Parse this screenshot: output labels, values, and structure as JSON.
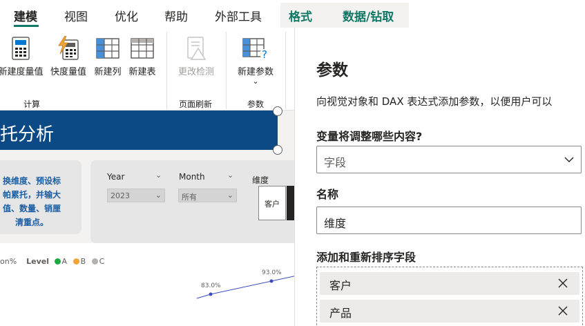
{
  "tabs": [
    {
      "label": "建模",
      "active": true
    },
    {
      "label": "视图"
    },
    {
      "label": "优化"
    },
    {
      "label": "帮助"
    },
    {
      "label": "外部工具"
    },
    {
      "label": "格式",
      "contextual": true
    },
    {
      "label": "数据/钻取",
      "contextual": true
    }
  ],
  "ribbon": {
    "buttons": {
      "new_measure": "新建度量值",
      "quick_measure": "快度量值",
      "new_column": "新建列",
      "new_table": "新建表",
      "change_detection": "更改检测",
      "new_parameter": "新建参数"
    },
    "groups": {
      "calc": "计算",
      "page_refresh": "页面刷新",
      "params": "参数"
    }
  },
  "report": {
    "title": "托分析",
    "description": "换维度、预设标帕累托，并输大值、数量、销厘清重点。",
    "filters": {
      "year_label": "Year",
      "year_value": "2023",
      "month_label": "Month",
      "month_value": "所有",
      "dimension_label": "维度",
      "dimension_button": "客户"
    },
    "legend": {
      "prefix": "on%",
      "level_label": "Level",
      "items": [
        {
          "label": "A",
          "color": "#1aab40"
        },
        {
          "label": "B",
          "color": "#f2a33a"
        },
        {
          "label": "C",
          "color": "#b3b0ad"
        }
      ]
    }
  },
  "chart_data": {
    "type": "line",
    "series": [
      {
        "values": [
          83.0,
          93.0
        ]
      }
    ],
    "data_labels": [
      "83.0%",
      "93.0%"
    ],
    "color": "#3a4bc0"
  },
  "pane": {
    "title": "参数",
    "description": "向视觉对象和 DAX 表达式添加参数，以便用户可以",
    "variable_label": "变量将调整哪些内容?",
    "variable_value": "字段",
    "name_label": "名称",
    "name_value": "维度",
    "fields_label": "添加和重新排序字段",
    "fields": [
      {
        "name": "客户"
      },
      {
        "name": "产品"
      }
    ]
  },
  "colors": {
    "accent": "#117865",
    "banner": "#0c4a86",
    "desc_text": "#1b5ea3"
  }
}
